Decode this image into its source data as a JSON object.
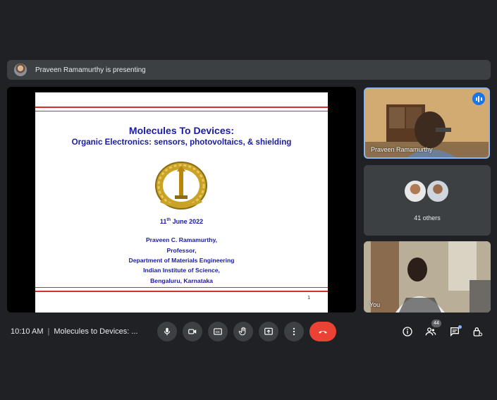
{
  "banner": {
    "text": "Praveen Ramamurthy is presenting"
  },
  "slide": {
    "title": "Molecules To Devices:",
    "subtitle": "Organic Electronics: sensors, photovoltaics, & shielding",
    "date_day": "11",
    "date_suffix": "th",
    "date_rest": " June 2022",
    "author_lines": [
      "Praveen C. Ramamurthy,",
      "Professor,",
      "Department of Materials Engineering",
      "Indian Institute of Science,",
      "Bengaluru, Karnataka"
    ],
    "page_number": "1"
  },
  "participants": {
    "presenter_name": "Praveen Ramamurthy",
    "others_label": "41 others",
    "self_label": "You"
  },
  "footer": {
    "time": "10:10 AM",
    "meeting_title": "Molecules to Devices: ...",
    "participant_count": "44"
  },
  "colors": {
    "background": "#202124",
    "end_call": "#ea4335",
    "speaking_accent": "#1a73e8",
    "slide_text": "#1a1aa6",
    "slide_rule": "#d32f2f"
  },
  "icons": {
    "controls": [
      "microphone-icon",
      "camera-icon",
      "captions-icon",
      "raise-hand-icon",
      "present-icon",
      "more-options-icon",
      "end-call-icon"
    ],
    "right": [
      "info-icon",
      "people-icon",
      "chat-icon",
      "host-controls-icon"
    ]
  }
}
